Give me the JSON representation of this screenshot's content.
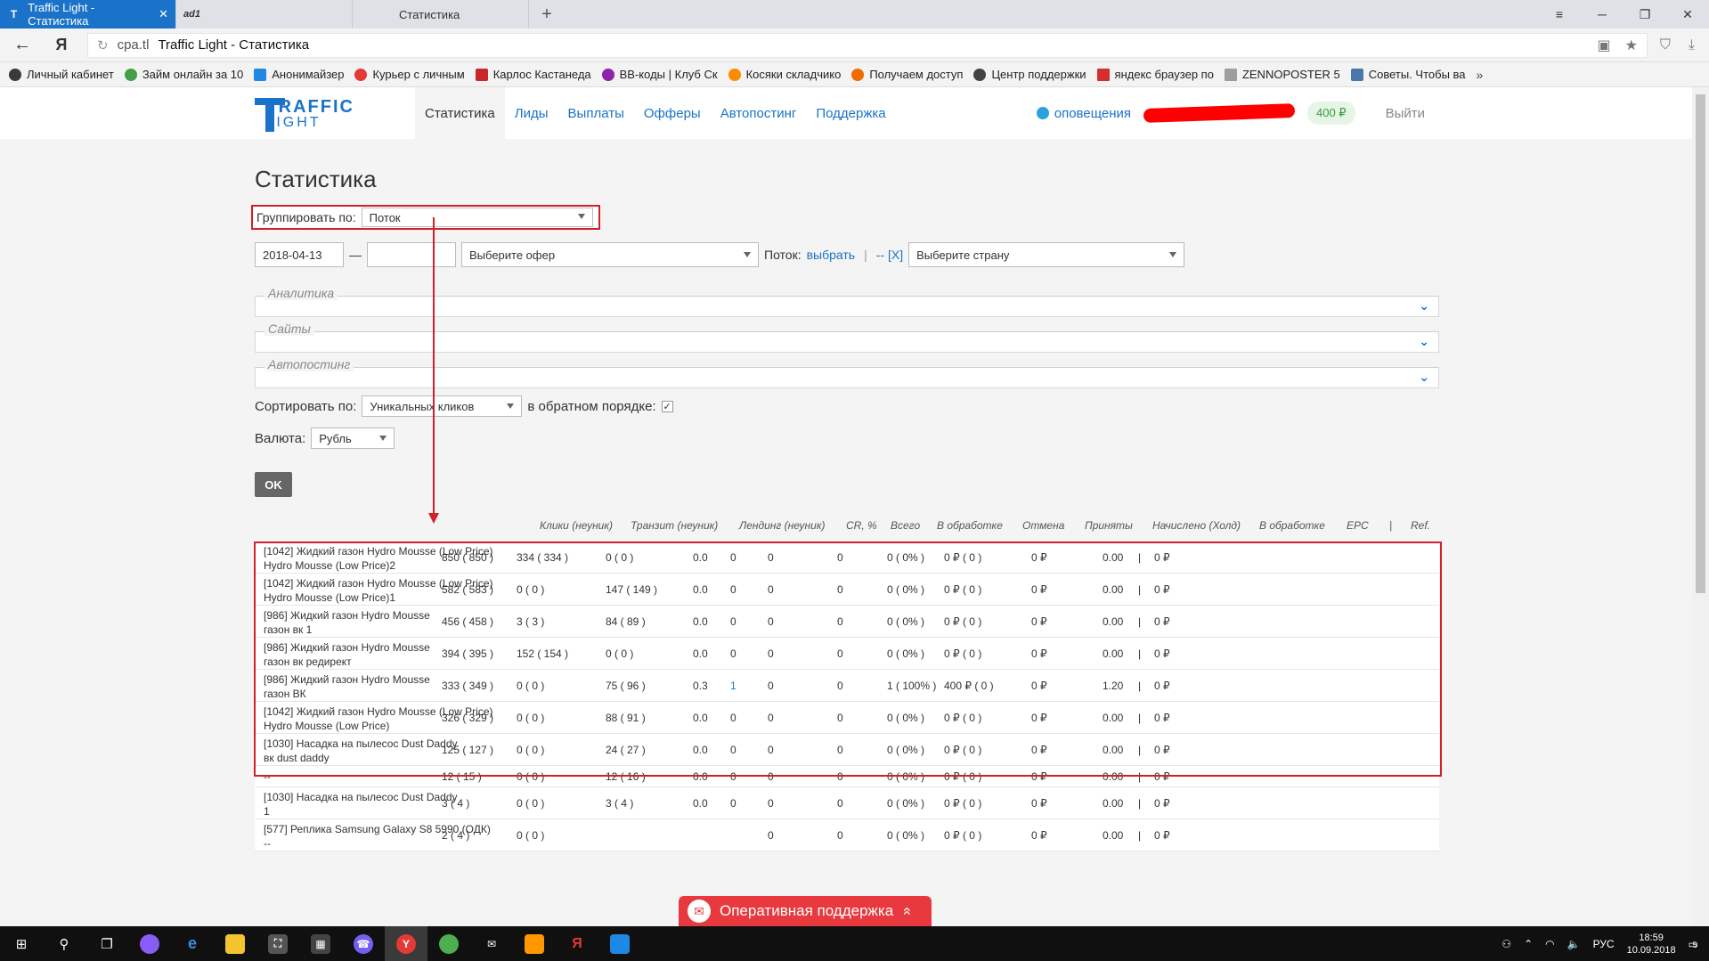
{
  "browser": {
    "tabs": [
      {
        "label": "Traffic Light - Статистика",
        "icon": "traffic-light-icon",
        "active": true
      },
      {
        "label": "ad1",
        "icon": "ad1-icon",
        "active": false
      },
      {
        "label": "Статистика",
        "icon": "",
        "active": false
      }
    ],
    "url_domain": "cpa.tl",
    "url_title": "Traffic Light - Статистика",
    "bookmarks": [
      {
        "label": "Личный кабинет",
        "color": "#3a3a3a"
      },
      {
        "label": "Займ онлайн за 10",
        "color": "#43a047"
      },
      {
        "label": "Анонимайзер",
        "color": "#1e88e5"
      },
      {
        "label": "Курьер с личным",
        "color": "#e53935"
      },
      {
        "label": "Карлос Кастанеда",
        "color": "#c62828"
      },
      {
        "label": "BB-коды | Клуб Ск",
        "color": "#8e24aa"
      },
      {
        "label": "Косяки складчико",
        "color": "#fb8c00"
      },
      {
        "label": "Получаем доступ",
        "color": "#ef6c00"
      },
      {
        "label": "Центр поддержки",
        "color": "#424242"
      },
      {
        "label": "яндекс браузер по",
        "color": "#d32f2f"
      },
      {
        "label": "ZENNOPOSTER 5",
        "color": "#9e9e9e"
      },
      {
        "label": "Советы. Чтобы ва",
        "color": "#4a76a8"
      }
    ]
  },
  "header": {
    "logo_line1": "TRAFFIC",
    "logo_line2": "LIGHT",
    "nav": [
      "Статистика",
      "Лиды",
      "Выплаты",
      "Офферы",
      "Автопостинг",
      "Поддержка"
    ],
    "notifications": "оповещения",
    "balance": "400 ₽",
    "logout": "Выйти"
  },
  "page": {
    "title": "Статистика",
    "group_label": "Группировать по:",
    "group_value": "Поток",
    "date_from": "2018-04-13",
    "date_to": "",
    "offer_placeholder": "Выберите офер",
    "stream_label": "Поток:",
    "stream_link": "выбрать",
    "sep": "|",
    "stream_clear": "-- [X]",
    "country_placeholder": "Выберите страну",
    "sections": [
      "Аналитика",
      "Сайты",
      "Автопостинг"
    ],
    "sort_label": "Сортировать по:",
    "sort_value": "Уникальных кликов",
    "reverse_label": "в обратном порядке:",
    "currency_label": "Валюта:",
    "currency_value": "Рубль",
    "ok": "OK"
  },
  "table": {
    "headers": [
      "Клики (неуник)",
      "Транзит (неуник)",
      "Лендинг (неуник)",
      "CR, %",
      "Всего",
      "В обработке",
      "Отмена",
      "Приняты",
      "Начислено (Холд)",
      "В обработке",
      "EPC",
      "|",
      "Ref."
    ],
    "rows": [
      {
        "name1": "[1042] Жидкий газон Hydro Mousse (Low Price)",
        "name2": "Hydro Mousse (Low Price)2",
        "clicks": "850  ( 850 )",
        "transit": "334  ( 334 )",
        "landing": "0  ( 0 )",
        "cr": "0.0",
        "total": "0",
        "proc": "0",
        "cancel": "0",
        "accepted": "0 ( 0% )",
        "accrued": "0 ₽ ( 0 )",
        "proc2": "0 ₽",
        "epc": "0.00",
        "sep": "|",
        "ref": "0 ₽"
      },
      {
        "name1": "[1042] Жидкий газон Hydro Mousse (Low Price)",
        "name2": "Hydro Mousse (Low Price)1",
        "clicks": "582  ( 583 )",
        "transit": "0  ( 0 )",
        "landing": "147  ( 149 )",
        "cr": "0.0",
        "total": "0",
        "proc": "0",
        "cancel": "0",
        "accepted": "0 ( 0% )",
        "accrued": "0 ₽ ( 0 )",
        "proc2": "0 ₽",
        "epc": "0.00",
        "sep": "|",
        "ref": "0 ₽"
      },
      {
        "name1": "[986] Жидкий газон Hydro Mousse",
        "name2": "газон вк 1",
        "clicks": "456  ( 458 )",
        "transit": "3  ( 3 )",
        "landing": "84  ( 89 )",
        "cr": "0.0",
        "total": "0",
        "proc": "0",
        "cancel": "0",
        "accepted": "0 ( 0% )",
        "accrued": "0 ₽ ( 0 )",
        "proc2": "0 ₽",
        "epc": "0.00",
        "sep": "|",
        "ref": "0 ₽"
      },
      {
        "name1": "[986] Жидкий газон Hydro Mousse",
        "name2": "газон вк редирект",
        "clicks": "394  ( 395 )",
        "transit": "152  ( 154 )",
        "landing": "0  ( 0 )",
        "cr": "0.0",
        "total": "0",
        "proc": "0",
        "cancel": "0",
        "accepted": "0 ( 0% )",
        "accrued": "0 ₽ ( 0 )",
        "proc2": "0 ₽",
        "epc": "0.00",
        "sep": "|",
        "ref": "0 ₽"
      },
      {
        "name1": "[986] Жидкий газон Hydro Mousse",
        "name2": "газон ВК",
        "clicks": "333  ( 349 )",
        "transit": "0  ( 0 )",
        "landing": "75  ( 96 )",
        "cr": "0.3",
        "total": "1",
        "proc": "0",
        "cancel": "0",
        "accepted": "1 ( 100% )",
        "accrued": "400 ₽ ( 0 )",
        "proc2": "0 ₽",
        "epc": "1.20",
        "sep": "|",
        "ref": "0 ₽"
      },
      {
        "name1": "[1042] Жидкий газон Hydro Mousse (Low Price)",
        "name2": "Hydro Mousse (Low Price)",
        "clicks": "326  ( 329 )",
        "transit": "0  ( 0 )",
        "landing": "88  ( 91 )",
        "cr": "0.0",
        "total": "0",
        "proc": "0",
        "cancel": "0",
        "accepted": "0 ( 0% )",
        "accrued": "0 ₽ ( 0 )",
        "proc2": "0 ₽",
        "epc": "0.00",
        "sep": "|",
        "ref": "0 ₽"
      },
      {
        "name1": "[1030] Насадка на пылесос Dust Daddy",
        "name2": "вк dust daddy",
        "clicks": "125  ( 127 )",
        "transit": "0  ( 0 )",
        "landing": "24  ( 27 )",
        "cr": "0.0",
        "total": "0",
        "proc": "0",
        "cancel": "0",
        "accepted": "0 ( 0% )",
        "accrued": "0 ₽ ( 0 )",
        "proc2": "0 ₽",
        "epc": "0.00",
        "sep": "|",
        "ref": "0 ₽"
      },
      {
        "name1": "--",
        "name2": "",
        "clicks": "12  ( 15 )",
        "transit": "0  ( 0 )",
        "landing": "12  ( 16 )",
        "cr": "0.0",
        "total": "0",
        "proc": "0",
        "cancel": "0",
        "accepted": "0 ( 0% )",
        "accrued": "0 ₽ ( 0 )",
        "proc2": "0 ₽",
        "epc": "0.00",
        "sep": "|",
        "ref": "0 ₽"
      },
      {
        "name1": "[1030] Насадка на пылесос Dust Daddy",
        "name2": "1",
        "clicks": "3  ( 4 )",
        "transit": "0  ( 0 )",
        "landing": "3  ( 4 )",
        "cr": "0.0",
        "total": "0",
        "proc": "0",
        "cancel": "0",
        "accepted": "0 ( 0% )",
        "accrued": "0 ₽ ( 0 )",
        "proc2": "0 ₽",
        "epc": "0.00",
        "sep": "|",
        "ref": "0 ₽"
      },
      {
        "name1": "[577] Реплика Samsung Galaxy S8 5990 (ОДК)",
        "name2": "--",
        "clicks": "2  ( 4 )",
        "transit": "0  ( 0 )",
        "landing": "",
        "cr": "",
        "total": "",
        "proc": "0",
        "cancel": "0",
        "accepted": "0 ( 0% )",
        "accrued": "0 ₽ ( 0 )",
        "proc2": "0 ₽",
        "epc": "0.00",
        "sep": "|",
        "ref": "0 ₽"
      }
    ]
  },
  "support": {
    "label": "Оперативная поддержка",
    "chev": "»"
  },
  "taskbar": {
    "lang": "РУС",
    "time": "18:59",
    "date": "10.09.2018",
    "notif_count": "5"
  }
}
